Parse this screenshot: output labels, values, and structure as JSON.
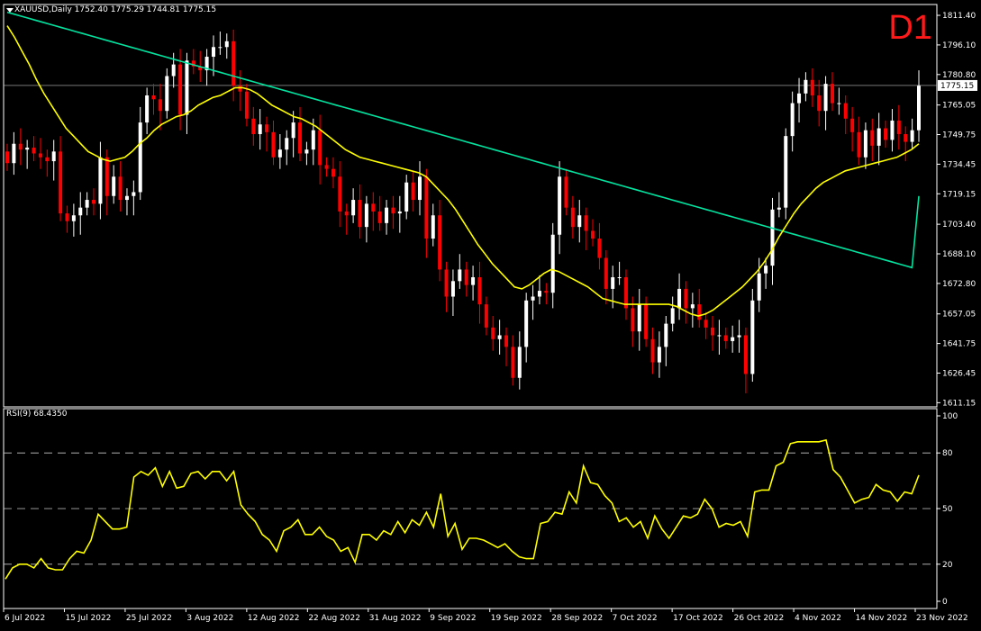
{
  "header": {
    "symbol_title": "XAUUSD,Daily  1752.40 1775.29 1744.81 1775.15",
    "timeframe": "D1",
    "rsi_title": "RSI(9) 68.4350"
  },
  "colors": {
    "background": "#000000",
    "bull": "#ffffff",
    "bear": "#ff0000",
    "ma_fast": "#ffff00",
    "ma_slow": "#00e5a0",
    "rsi": "#ffff00",
    "grid_frame": "#ffffff"
  },
  "chart_data": [
    {
      "type": "candlestick",
      "title": "XAUUSD,Daily",
      "ylim": [
        1609,
        1817
      ],
      "y_ticks": [
        "1811.40",
        "1796.10",
        "1780.80",
        "1765.05",
        "1749.75",
        "1734.45",
        "1719.15",
        "1703.40",
        "1688.10",
        "1672.80",
        "1657.05",
        "1641.75",
        "1626.45",
        "1611.15"
      ],
      "x_ticks": [
        "6 Jul 2022",
        "15 Jul 2022",
        "25 Jul 2022",
        "3 Aug 2022",
        "12 Aug 2022",
        "22 Aug 2022",
        "31 Aug 2022",
        "9 Sep 2022",
        "19 Sep 2022",
        "28 Sep 2022",
        "7 Oct 2022",
        "17 Oct 2022",
        "26 Oct 2022",
        "4 Nov 2022",
        "14 Nov 2022",
        "23 Nov 2022"
      ],
      "current_price": "1775.15",
      "closes": [
        1735,
        1745,
        1742,
        1743,
        1740,
        1738,
        1736,
        1741,
        1709,
        1705,
        1708,
        1712,
        1716,
        1714,
        1738,
        1718,
        1728,
        1716,
        1718,
        1720,
        1756,
        1770,
        1768,
        1762,
        1780,
        1786,
        1760,
        1788,
        1785,
        1783,
        1790,
        1795,
        1795,
        1798,
        1775,
        1772,
        1758,
        1750,
        1755,
        1751,
        1738,
        1742,
        1748,
        1756,
        1740,
        1742,
        1752,
        1734,
        1732,
        1728,
        1710,
        1708,
        1716,
        1702,
        1714,
        1710,
        1704,
        1712,
        1709,
        1710,
        1725,
        1716,
        1728,
        1696,
        1708,
        1680,
        1666,
        1674,
        1680,
        1672,
        1676,
        1662,
        1650,
        1644,
        1646,
        1640,
        1624,
        1640,
        1664,
        1666,
        1669,
        1668,
        1698,
        1728,
        1712,
        1702,
        1708,
        1700,
        1696,
        1686,
        1670,
        1676,
        1676,
        1660,
        1648,
        1662,
        1644,
        1632,
        1640,
        1652,
        1660,
        1670,
        1660,
        1662,
        1654,
        1650,
        1646,
        1646,
        1643,
        1645,
        1646,
        1626,
        1664,
        1678,
        1682,
        1711,
        1712,
        1749,
        1766,
        1771,
        1778,
        1770,
        1762,
        1776,
        1766,
        1766,
        1758,
        1751,
        1738,
        1752,
        1744,
        1753,
        1747,
        1757,
        1750,
        1746,
        1752,
        1775
      ],
      "ma_fast": [
        1806,
        1800,
        1793,
        1786,
        1778,
        1771,
        1765,
        1759,
        1753,
        1749,
        1745,
        1741,
        1739,
        1737,
        1736,
        1737,
        1738,
        1741,
        1745,
        1748,
        1752,
        1755,
        1757,
        1759,
        1760,
        1762,
        1765,
        1767,
        1769,
        1770,
        1772,
        1774,
        1774,
        1773,
        1771,
        1768,
        1765,
        1763,
        1761,
        1759,
        1758,
        1756,
        1754,
        1751,
        1748,
        1745,
        1742,
        1740,
        1738,
        1737,
        1736,
        1735,
        1734,
        1733,
        1732,
        1731,
        1730,
        1728,
        1724,
        1720,
        1716,
        1711,
        1705,
        1699,
        1693,
        1688,
        1683,
        1679,
        1675,
        1671,
        1670,
        1672,
        1675,
        1678,
        1680,
        1679,
        1677,
        1675,
        1673,
        1671,
        1668,
        1665,
        1664,
        1663,
        1662,
        1662,
        1662,
        1662,
        1662,
        1662,
        1662,
        1661,
        1659,
        1657,
        1656,
        1657,
        1659,
        1662,
        1665,
        1668,
        1671,
        1675,
        1679,
        1684,
        1690,
        1697,
        1703,
        1709,
        1714,
        1718,
        1722,
        1725,
        1727,
        1729,
        1731,
        1732,
        1733,
        1734,
        1735,
        1736,
        1737,
        1738,
        1740,
        1742,
        1745
      ],
      "ma_slow": [
        1813,
        1812,
        1811,
        1810,
        1809,
        1808,
        1807,
        1806,
        1805,
        1804,
        1803,
        1802,
        1801,
        1800,
        1799,
        1798,
        1797,
        1796,
        1795,
        1794,
        1793,
        1792,
        1791,
        1790,
        1789,
        1788,
        1787,
        1786,
        1785,
        1784,
        1783,
        1782,
        1781,
        1780,
        1779,
        1778,
        1777,
        1776,
        1775,
        1774,
        1773,
        1772,
        1771,
        1770,
        1769,
        1768,
        1767,
        1766,
        1765,
        1764,
        1763,
        1762,
        1761,
        1760,
        1759,
        1758,
        1757,
        1756,
        1755,
        1754,
        1753,
        1752,
        1751,
        1750,
        1749,
        1748,
        1747,
        1746,
        1745,
        1744,
        1743,
        1742,
        1741,
        1740,
        1739,
        1738,
        1737,
        1736,
        1735,
        1734,
        1733,
        1732,
        1731,
        1730,
        1729,
        1728,
        1727,
        1726,
        1725,
        1724,
        1723,
        1722,
        1721,
        1720,
        1719,
        1718,
        1717,
        1716,
        1715,
        1714,
        1713,
        1712,
        1711,
        1710,
        1709,
        1708,
        1707,
        1706,
        1705,
        1704,
        1703,
        1702,
        1701,
        1700,
        1699,
        1698,
        1697,
        1696,
        1695,
        1694,
        1693,
        1692,
        1691,
        1690,
        1689,
        1688,
        1687,
        1686,
        1685,
        1684,
        1683,
        1682,
        1681,
        1718
      ]
    },
    {
      "type": "line",
      "title": "RSI(9)",
      "ylim": [
        0,
        100
      ],
      "y_ticks": [
        "100",
        "80",
        "50",
        "20",
        "0"
      ],
      "levels": [
        80,
        50,
        20
      ],
      "values": [
        12,
        18,
        20,
        20,
        18,
        23,
        18,
        17,
        17,
        23,
        27,
        26,
        33,
        47,
        43,
        39,
        39,
        40,
        67,
        70,
        68,
        72,
        62,
        70,
        61,
        62,
        69,
        70,
        66,
        70,
        70,
        65,
        70,
        52,
        47,
        43,
        36,
        33,
        27,
        38,
        40,
        44,
        36,
        36,
        40,
        35,
        33,
        27,
        29,
        21,
        36,
        36,
        33,
        38,
        36,
        43,
        37,
        44,
        41,
        48,
        40,
        58,
        35,
        42,
        28,
        34,
        34,
        33,
        31,
        29,
        31,
        27,
        24,
        23,
        23,
        42,
        43,
        48,
        47,
        59,
        53,
        73,
        64,
        63,
        57,
        53,
        43,
        45,
        40,
        43,
        34,
        46,
        39,
        34,
        40,
        46,
        45,
        47,
        55,
        50,
        40,
        42,
        41,
        43,
        35,
        59,
        60,
        60,
        73,
        75,
        85,
        86,
        86,
        86,
        86,
        87,
        71,
        67,
        60,
        53,
        55,
        56,
        63,
        60,
        59,
        54,
        59,
        58,
        68
      ]
    }
  ]
}
